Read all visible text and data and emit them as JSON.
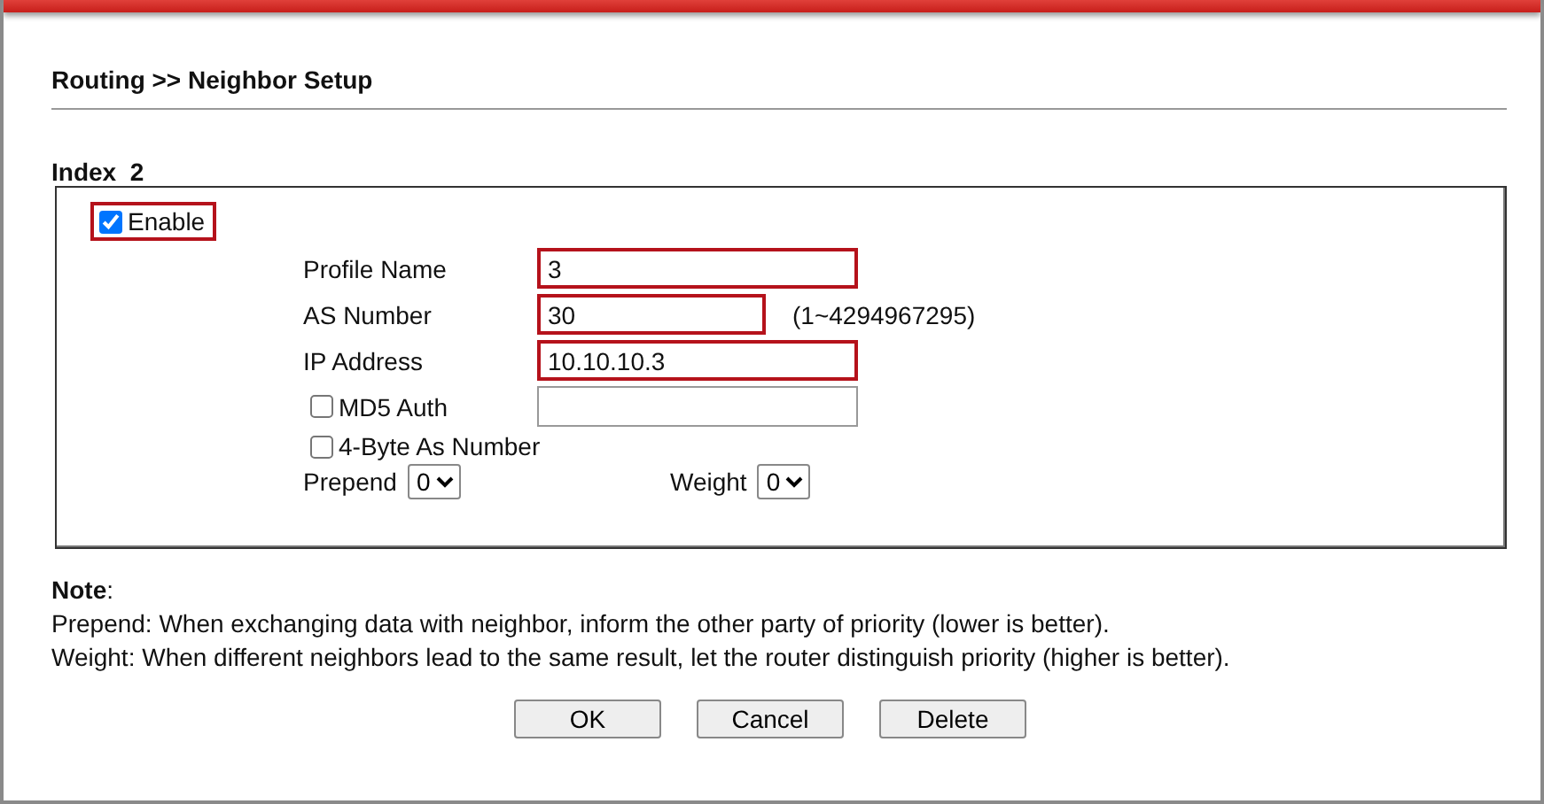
{
  "title": "Routing >> Neighbor Setup",
  "index_label": "Index  2",
  "enable": {
    "label": "Enable",
    "checked": true,
    "highlighted": true
  },
  "fields": [
    {
      "kind": "text",
      "label": "Profile Name",
      "value": "3",
      "highlighted": true
    },
    {
      "kind": "text",
      "label": "AS Number",
      "value": "30",
      "highlighted": true,
      "hint": "(1~4294967295)"
    },
    {
      "kind": "text",
      "label": "IP Address",
      "value": "10.10.10.3",
      "highlighted": true
    },
    {
      "kind": "checktext",
      "label": "MD5 Auth",
      "checked": false,
      "highlighted": false
    },
    {
      "kind": "check",
      "label": "4-Byte As Number",
      "checked": false
    }
  ],
  "selects": [
    {
      "label": "Prepend",
      "value": "0"
    },
    {
      "label": "Weight",
      "value": "0"
    }
  ],
  "note": {
    "heading": "**Note**:",
    "lines": [
      "Prepend: When exchanging data with neighbor, inform the other party of priority (lower is better).",
      "Weight: When different neighbors lead to the same result, let the router distinguish priority (higher is better)."
    ]
  },
  "buttons": [
    "OK",
    "Cancel",
    "Delete"
  ]
}
